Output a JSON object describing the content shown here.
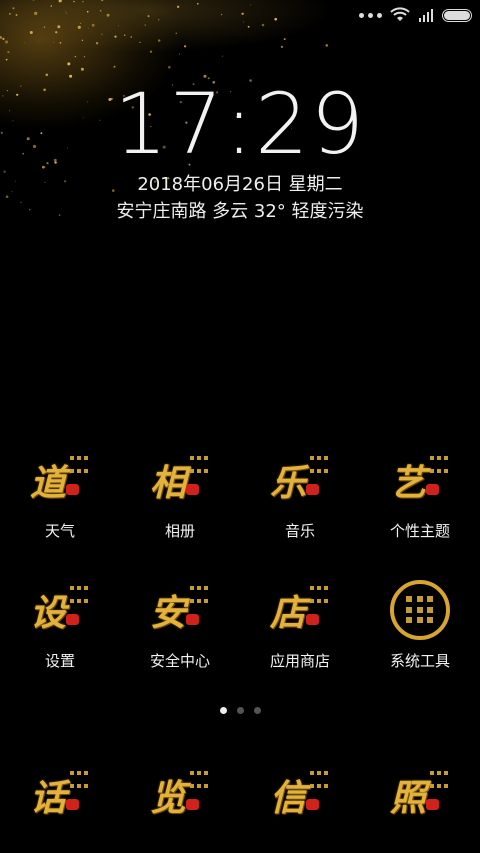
{
  "lockscreen": {
    "time": "17:29",
    "date": "2018年06月26日 星期二",
    "weather": "安宁庄南路  多云 32° 轻度污染"
  },
  "status_bar": {
    "icons": [
      "more-dots-icon",
      "wifi-icon",
      "signal-icon",
      "battery-icon"
    ]
  },
  "apps_row1": [
    {
      "label": "天气",
      "glyph": "道",
      "icon": "weather-icon"
    },
    {
      "label": "相册",
      "glyph": "相",
      "icon": "gallery-icon"
    },
    {
      "label": "音乐",
      "glyph": "乐",
      "icon": "music-icon"
    },
    {
      "label": "个性主题",
      "glyph": "艺",
      "icon": "theme-icon"
    }
  ],
  "apps_row2": [
    {
      "label": "设置",
      "glyph": "设",
      "icon": "settings-icon"
    },
    {
      "label": "安全中心",
      "glyph": "安",
      "icon": "security-icon"
    },
    {
      "label": "应用商店",
      "glyph": "店",
      "icon": "store-icon"
    },
    {
      "label": "系统工具",
      "glyph": "",
      "icon": "tools-folder-icon"
    }
  ],
  "dock": [
    {
      "glyph": "话",
      "icon": "phone-icon"
    },
    {
      "glyph": "览",
      "icon": "browser-icon"
    },
    {
      "glyph": "信",
      "icon": "messages-icon"
    },
    {
      "glyph": "照",
      "icon": "camera-icon"
    }
  ],
  "page_indicator": {
    "pages": 3,
    "active": 1
  },
  "colors": {
    "gold": "#e2b23a",
    "seal_red": "#d0211b",
    "background": "#000000"
  }
}
